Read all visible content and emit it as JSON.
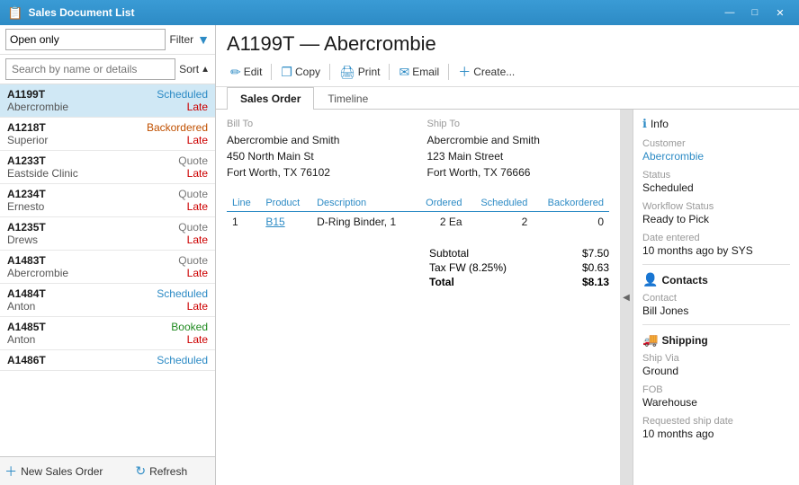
{
  "titleBar": {
    "icon": "📋",
    "title": "Sales Document List",
    "minBtn": "—",
    "maxBtn": "□",
    "closeBtn": "✕"
  },
  "leftPanel": {
    "filterLabel": "Filter",
    "filterOption": "Open only",
    "searchPlaceholder": "Search by name or details",
    "sortLabel": "Sort",
    "sortIcon": "▲",
    "documents": [
      {
        "id": "A1199T",
        "status": "Scheduled",
        "statusClass": "status-scheduled",
        "name": "Abercrombie",
        "late": "Late",
        "selected": true
      },
      {
        "id": "A1218T",
        "status": "Backordered",
        "statusClass": "status-backordered",
        "name": "Superior",
        "late": "Late",
        "selected": false
      },
      {
        "id": "A1233T",
        "status": "Quote",
        "statusClass": "status-quote",
        "name": "Eastside Clinic",
        "late": "Late",
        "selected": false
      },
      {
        "id": "A1234T",
        "status": "Quote",
        "statusClass": "status-quote",
        "name": "Ernesto",
        "late": "Late",
        "selected": false
      },
      {
        "id": "A1235T",
        "status": "Quote",
        "statusClass": "status-quote",
        "name": "Drews",
        "late": "Late",
        "selected": false
      },
      {
        "id": "A1483T",
        "status": "Quote",
        "statusClass": "status-quote",
        "name": "Abercrombie",
        "late": "Late",
        "selected": false
      },
      {
        "id": "A1484T",
        "status": "Scheduled",
        "statusClass": "status-scheduled",
        "name": "Anton",
        "late": "Late",
        "selected": false
      },
      {
        "id": "A1485T",
        "status": "Booked",
        "statusClass": "status-booked",
        "name": "Anton",
        "late": "Late",
        "selected": false
      },
      {
        "id": "A1486T",
        "status": "Scheduled",
        "statusClass": "status-scheduled",
        "name": "",
        "late": "",
        "selected": false
      }
    ],
    "newBtn": "New Sales Order",
    "refreshBtn": "Refresh"
  },
  "header": {
    "title": "A1199T — Abercrombie",
    "toolbar": {
      "editIcon": "✏️",
      "editLabel": "Edit",
      "copyIcon": "📋",
      "copyLabel": "Copy",
      "printIcon": "🖨️",
      "printLabel": "Print",
      "emailIcon": "📧",
      "emailLabel": "Email",
      "createIcon": "+",
      "createLabel": "Create..."
    }
  },
  "tabs": [
    {
      "id": "sales-order",
      "label": "Sales Order",
      "active": true
    },
    {
      "id": "timeline",
      "label": "Timeline",
      "active": false
    }
  ],
  "mainContent": {
    "billTo": {
      "label": "Bill To",
      "name": "Abercrombie and Smith",
      "address1": "450 North Main St",
      "address2": "Fort Worth, TX  76102"
    },
    "shipTo": {
      "label": "Ship To",
      "name": "Abercrombie and Smith",
      "address1": "123 Main Street",
      "address2": "Fort Worth, TX  76666"
    },
    "tableHeaders": [
      "Line",
      "Product",
      "Description",
      "Ordered",
      "Scheduled",
      "Backordered"
    ],
    "tableRows": [
      {
        "line": "1",
        "product": "B15",
        "description": "D-Ring Binder, 1",
        "ordered": "2 Ea",
        "scheduled": "2",
        "backordered": "0"
      }
    ],
    "subtotal": "$7.50",
    "subtotalLabel": "Subtotal",
    "taxLabel": "Tax FW (8.25%)",
    "taxAmount": "$0.63",
    "totalLabel": "Total",
    "totalAmount": "$8.13"
  },
  "infoPanel": {
    "sectionTitle": "Info",
    "fields": [
      {
        "label": "Customer",
        "value": "Abercrombie",
        "isLink": true
      },
      {
        "label": "Status",
        "value": "Scheduled",
        "isLink": false
      },
      {
        "label": "Workflow Status",
        "value": "Ready to Pick",
        "isLink": false
      },
      {
        "label": "Date entered",
        "value": "10 months ago by SYS",
        "isLink": false
      }
    ],
    "contactsTitle": "Contacts",
    "contactFields": [
      {
        "label": "Contact",
        "value": "Bill Jones",
        "isLink": false
      }
    ],
    "shippingTitle": "Shipping",
    "shippingFields": [
      {
        "label": "Ship Via",
        "value": "Ground",
        "isLink": false
      },
      {
        "label": "FOB",
        "value": "Warehouse",
        "isLink": false
      },
      {
        "label": "Requested ship date",
        "value": "10 months ago",
        "isLink": false
      }
    ]
  }
}
